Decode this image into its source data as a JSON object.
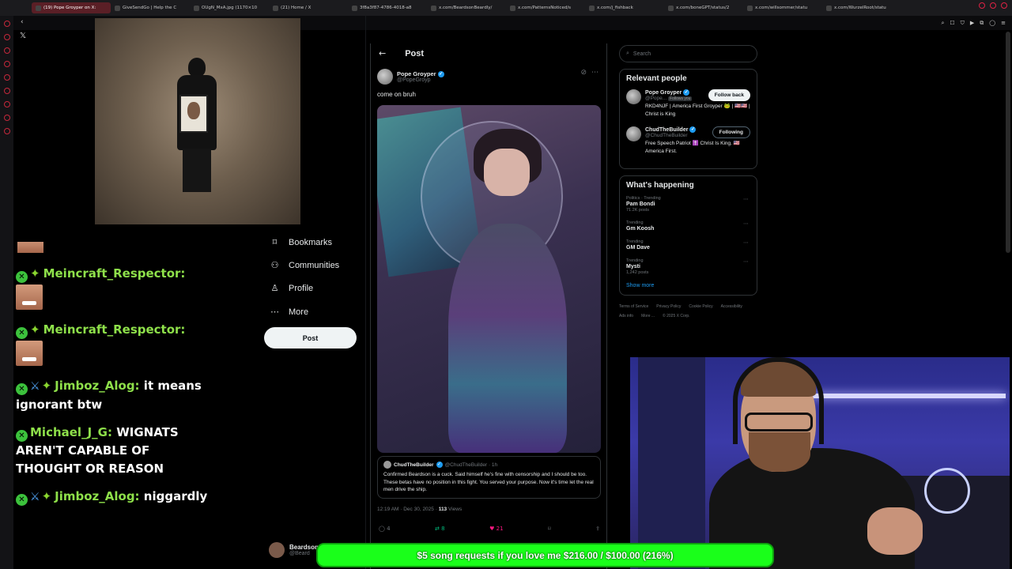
{
  "browser": {
    "tabs": [
      {
        "label": "(19) Pope Groyper on X:"
      },
      {
        "label": "GiveSendGo | Help the C"
      },
      {
        "label": "OUgN_MxA.jpg (1170×10"
      },
      {
        "label": "(21) Home / X"
      },
      {
        "label": "3f8a3f87-4786-4018-a8"
      },
      {
        "label": "x.com/BeardsonBeardly/"
      },
      {
        "label": "x.com/PatternsNoticed/s"
      },
      {
        "label": "x.com/j_fishback"
      },
      {
        "label": "x.com/boneGPT/status/2"
      },
      {
        "label": "x.com/willsommer/statu"
      },
      {
        "label": "x.com/WurzelRoot/statu"
      }
    ]
  },
  "chat": {
    "messages": [
      {
        "user": "Meincraft_Respector:",
        "text": ""
      },
      {
        "user": "Meincraft_Respector:",
        "text": ""
      },
      {
        "user": "Jimboz_Alog:",
        "text": "it means ignorant btw"
      },
      {
        "user": "Michael_J_G:",
        "text": "WIGNATS AREN'T CAPABLE OF THOUGHT OR REASON"
      },
      {
        "user": "Jimboz_Alog:",
        "text": "niggardly"
      }
    ]
  },
  "nav": {
    "items": [
      {
        "label": "Bookmarks",
        "icon": "bookmark-icon"
      },
      {
        "label": "Communities",
        "icon": "communities-icon"
      },
      {
        "label": "Profile",
        "icon": "profile-icon"
      },
      {
        "label": "More",
        "icon": "more-icon"
      }
    ],
    "post_label": "Post",
    "account_name": "Beardson",
    "account_handle": "@Beard"
  },
  "post": {
    "header_title": "Post",
    "author_name": "Pope Groyper",
    "author_handle": "@PopeGroyp",
    "text": "come on bruh",
    "quote": {
      "name": "ChudTheBuilder",
      "handle": "@ChudTheBuilder · 1h",
      "text": "Confirmed Beardson is a cuck. Said himself he's fine with censorship and I should be too. These betas have no position in this fight. You served your purpose. Now it's time let the real men drive the ship."
    },
    "meta_time": "12:19 AM · Dec 30, 2025 · ",
    "views_count": "113",
    "views_label": " Views",
    "actions": {
      "replies": "4",
      "reposts": "8",
      "likes": "21"
    }
  },
  "sidebar": {
    "search_placeholder": "Search",
    "relevant_title": "Relevant people",
    "people": [
      {
        "name": "Pope Groyper",
        "handle": "@Pope...",
        "follows_you": "Follows you",
        "bio": "RKD4NJF | America First Groyper 🐸 | 🇺🇸🇺🇸 | Christ is King",
        "button": "Follow back"
      },
      {
        "name": "ChudTheBuilder",
        "handle": "@ChudTheBuilder",
        "follows_you": "",
        "bio": "Free Speech Patriot ✝️ Christ Is King. 🇺🇸 America First.",
        "button": "Following"
      }
    ],
    "happening_title": "What's happening",
    "trends": [
      {
        "category": "Politics · Trending",
        "topic": "Pam Bondi",
        "count": "71.2K posts"
      },
      {
        "category": "Trending",
        "topic": "Gm Koosh",
        "count": ""
      },
      {
        "category": "Trending",
        "topic": "GM Dave",
        "count": ""
      },
      {
        "category": "Trending",
        "topic": "Mysti",
        "count": "1,242 posts"
      }
    ],
    "show_more": "Show more",
    "footer": [
      "Terms of Service",
      "Privacy Policy",
      "Cookie Policy",
      "Accessibility",
      "Ads info",
      "More ...",
      "© 2025 X Corp."
    ]
  },
  "overlay": {
    "goal_text": "$5 song requests if you love me $216.00 / $100.00 (216%)"
  }
}
